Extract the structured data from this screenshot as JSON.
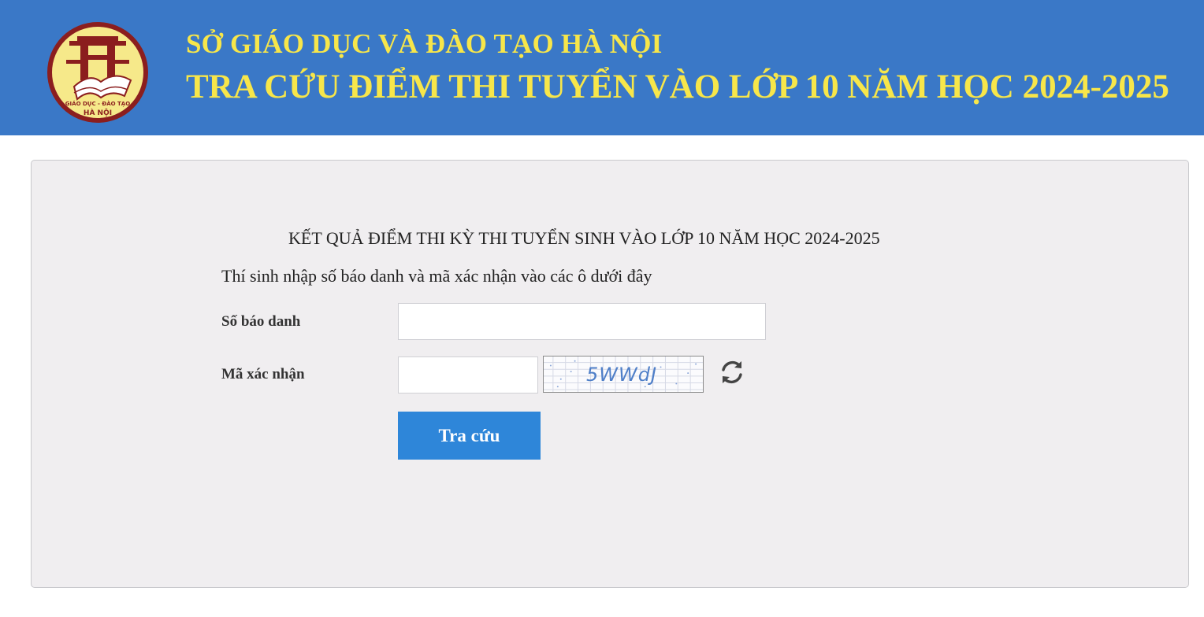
{
  "header": {
    "line1": "SỞ GIÁO DỤC VÀ ĐÀO TẠO HÀ NỘI",
    "line2": "TRA CỨU ĐIỂM THI TUYỂN VÀO LỚP 10 NĂM HỌC 2024-2025",
    "logo": {
      "icon": "hanoi-education-logo-icon",
      "text_top": "GIÁO DỤC - ĐÀO TẠO",
      "text_bottom": "HÀ NỘI"
    },
    "colors": {
      "background": "#3a78c7",
      "text": "#f7e64a"
    }
  },
  "form": {
    "title": "KẾT QUẢ ĐIỂM THI KỲ THI TUYỂN SINH VÀO LỚP 10 NĂM HỌC 2024-2025",
    "instruction": "Thí sinh nhập số báo danh và mã xác nhận vào các ô dưới đây",
    "sbd_label": "Số báo danh",
    "sbd_value": "",
    "captcha_label": "Mã xác nhận",
    "captcha_value": "",
    "captcha_text": "5WWdJ",
    "refresh_icon": "refresh-icon",
    "submit_label": "Tra cứu",
    "colors": {
      "panel": "#f0eef0",
      "button": "#2e86d9"
    }
  }
}
